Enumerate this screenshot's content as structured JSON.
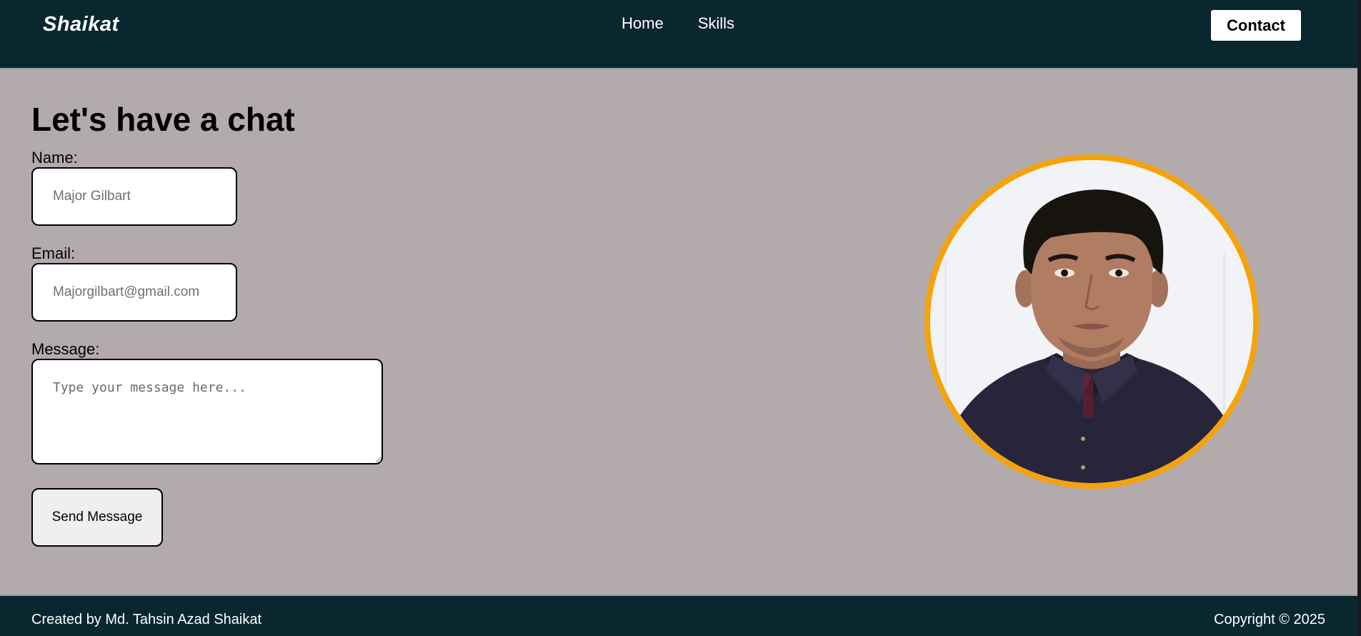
{
  "nav": {
    "logo": "Shaikat",
    "links": [
      {
        "label": "Home"
      },
      {
        "label": "Skills"
      }
    ],
    "contact_label": "Contact"
  },
  "form": {
    "heading": "Let's have a chat",
    "name_label": "Name:",
    "name_placeholder": "Major Gilbart",
    "email_label": "Email:",
    "email_placeholder": "Majorgilbart@gmail.com",
    "message_label": "Message:",
    "message_placeholder": "Type your message here...",
    "send_label": "Send Message"
  },
  "profile": {
    "ring_color": "#f5a30a"
  },
  "footer": {
    "credit": "Created by Md. Tahsin Azad Shaikat",
    "copyright": "Copyright © 2025"
  },
  "colors": {
    "nav_bg": "#0a2730",
    "page_bg": "#b3abab"
  }
}
